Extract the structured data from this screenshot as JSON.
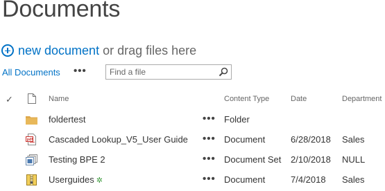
{
  "page_title": "Documents",
  "toolbar": {
    "new_document_label": "new document",
    "drag_text": "or drag files here"
  },
  "views": {
    "current": "All Documents",
    "more": "•••"
  },
  "search": {
    "placeholder": "Find a file",
    "value": ""
  },
  "columns": {
    "check": "✓",
    "name": "Name",
    "content_type": "Content Type",
    "date": "Date",
    "department": "Department"
  },
  "rows": [
    {
      "name": "foldertest",
      "icon": "folder-icon",
      "more": "•••",
      "content_type": "Folder",
      "date": "",
      "department": ""
    },
    {
      "name": "Cascaded Lookup_V5_User Guide",
      "icon": "pdf-icon",
      "more": "•••",
      "content_type": "Document",
      "date": "6/28/2018",
      "department": "Sales"
    },
    {
      "name": "Testing BPE 2",
      "icon": "document-set-icon",
      "more": "•••",
      "content_type": "Document Set",
      "date": "2/10/2018",
      "department": "NULL"
    },
    {
      "name": "Userguides",
      "icon": "zip-icon",
      "new_badge": "✲",
      "more": "•••",
      "content_type": "Document",
      "date": "7/4/2018",
      "department": "Sales"
    }
  ],
  "colors": {
    "accent": "#0072c6",
    "folder": "#e8b85a",
    "new_badge": "#3c9a3c"
  }
}
